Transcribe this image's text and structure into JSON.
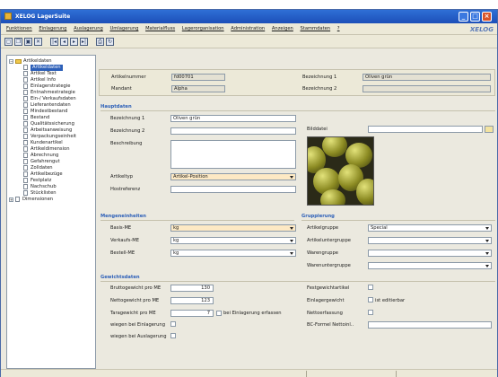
{
  "window": {
    "title": "XELOG LagerSuite",
    "brand": "XELOG"
  },
  "menu": [
    "Funktionen",
    "Einlagerung",
    "Auslagerung",
    "Umlagerung",
    "Materialfluss",
    "Lagerorganisation",
    "Administration",
    "Anzeigen",
    "Stammdaten",
    "?"
  ],
  "tree": {
    "root": "Artikeldaten",
    "items": [
      "Artikeldaten",
      "Artikel Text",
      "Artikel Info",
      "Einlagerstrategie",
      "Entnahmestrategie",
      "Ein-/ Verkaufsdaten",
      "Lieferantendaten",
      "Mindestbestand",
      "Bestand",
      "Qualitätssicherung",
      "Arbeitsanweisung",
      "Verpackungseinheit",
      "Kundenartikel",
      "Artikeldimension",
      "Abrechnung",
      "Gefahrengut",
      "Zolldaten",
      "Artikelbezüge",
      "Festplatz",
      "Nachschub",
      "Stücklisten"
    ],
    "second_root": "Dimensionen"
  },
  "header": {
    "artikelnummer_label": "Artikelnummer",
    "artikelnummer": "fd00701",
    "mandant_label": "Mandant",
    "mandant": "Alpha",
    "bez1_label": "Bezeichnung 1",
    "bez1": "Oliven grün",
    "bez2_label": "Bezeichnung 2",
    "bez2": ""
  },
  "hauptdaten": {
    "title": "Hauptdaten",
    "bez1_label": "Bezeichnung 1",
    "bez1": "Oliven grün",
    "bez2_label": "Bezeichnung 2",
    "bez2": "",
    "beschreibung_label": "Beschreibung",
    "beschreibung": "",
    "artikeltyp_label": "Artikeltyp",
    "artikeltyp": "Artikel-Position",
    "hostreferenz_label": "Hostreferenz",
    "hostreferenz": "",
    "bilddatei_label": "Bilddatei",
    "bilddatei": ""
  },
  "mengeneinheiten": {
    "title": "Mengeneinheiten",
    "basis_label": "Basis-ME",
    "basis": "kg",
    "verkaufs_label": "Verkaufs-ME",
    "verkaufs": "kg",
    "bestell_label": "Bestell-ME",
    "bestell": "kg"
  },
  "gruppierung": {
    "title": "Gruppierung",
    "artikelgruppe_label": "Artikelgruppe",
    "artikelgruppe": "Special",
    "artikeluntergruppe_label": "Artikeluntergruppe",
    "artikeluntergruppe": "",
    "warengruppe_label": "Warengruppe",
    "warengruppe": "",
    "warenuntergruppe_label": "Warenuntergruppe",
    "warenuntergruppe": ""
  },
  "gewichtsdaten": {
    "title": "Gewichtsdaten",
    "brutto_label": "Bruttogewicht pro ME",
    "brutto": "130",
    "netto_label": "Nettogewicht pro ME",
    "netto": "123",
    "tara_label": "Taragewicht pro ME",
    "tara": "7",
    "bei_einlagerung_erfassen": "bei Einlagerung erfassen",
    "wiegen_ein_label": "wiegen bei Einlagerung",
    "wiegen_aus_label": "wiegen bei Auslagerung",
    "festgewicht_label": "Festgewichtartikel",
    "einlagergewicht_label": "Einlagergewicht",
    "ist_editierbar": "ist editierbar",
    "nettoerfassung_label": "Nettoerfassung",
    "bc_formel_label": "BC-Formel Nettoinl..",
    "bc_formel": ""
  },
  "status": {
    "left": "",
    "middle": "",
    "right": ""
  }
}
